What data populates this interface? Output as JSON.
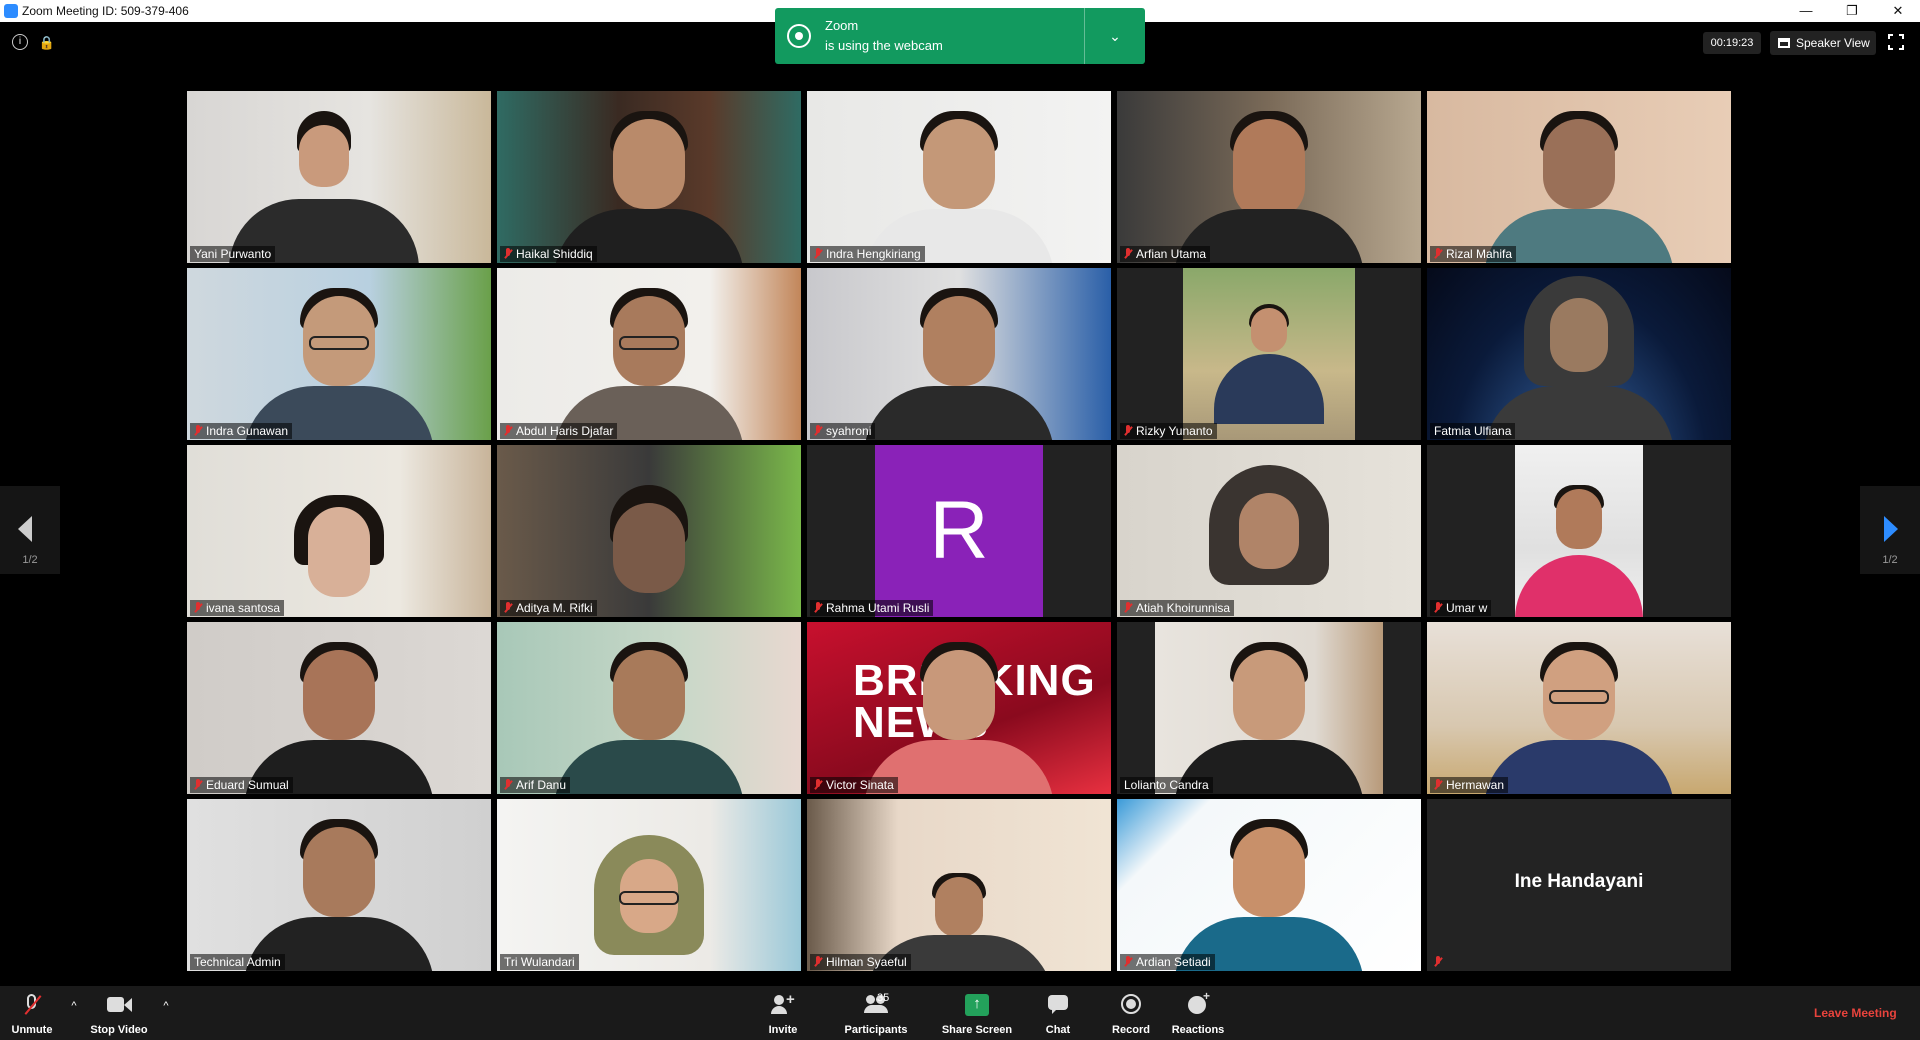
{
  "window": {
    "title": "Zoom Meeting ID: 509-379-406",
    "minimize": "—",
    "restore": "❐",
    "close": "✕"
  },
  "notification": {
    "line1": "Zoom",
    "line2": "is using the webcam",
    "chevron": "⌄"
  },
  "topbar": {
    "timer": "00:19:23",
    "speaker_view": "Speaker View",
    "info": "i",
    "lock": "🔒"
  },
  "pager": {
    "left_page": "1/2",
    "right_page": "1/2"
  },
  "participants": [
    {
      "name": "Yani Purwanto",
      "muted": false,
      "active": true
    },
    {
      "name": "Haikal Shiddiq",
      "muted": true
    },
    {
      "name": "Indra Hengkiriang",
      "muted": true
    },
    {
      "name": "Arfian Utama",
      "muted": true
    },
    {
      "name": "Rizal Mahifa",
      "muted": true
    },
    {
      "name": "Indra Gunawan",
      "muted": true
    },
    {
      "name": "Abdul Haris Djafar",
      "muted": true
    },
    {
      "name": "syahroni",
      "muted": true
    },
    {
      "name": "Rizky Yunanto",
      "muted": true
    },
    {
      "name": "Fatmia Ulfiana",
      "muted": false
    },
    {
      "name": "ivana santosa",
      "muted": true
    },
    {
      "name": "Aditya M. Rifki",
      "muted": true
    },
    {
      "name": "Rahma Utami Rusli",
      "muted": true,
      "avatar": "R"
    },
    {
      "name": "Atiah Khoirunnisa",
      "muted": true
    },
    {
      "name": "Umar w",
      "muted": true
    },
    {
      "name": "Eduard Sumual",
      "muted": true
    },
    {
      "name": "Arif Danu",
      "muted": true
    },
    {
      "name": "Victor Sinata",
      "muted": true
    },
    {
      "name": "Lolianto Candra",
      "muted": false
    },
    {
      "name": "Hermawan",
      "muted": true
    },
    {
      "name": "Technical Admin",
      "muted": false
    },
    {
      "name": "Tri Wulandari",
      "muted": false
    },
    {
      "name": "Hilman Syaeful",
      "muted": true
    },
    {
      "name": "Ardian Setiadi",
      "muted": true
    },
    {
      "name": "Ine Handayani",
      "muted": true,
      "video_off": true
    }
  ],
  "tile_text": {
    "victor_bg_text": "BREAKING NEWS"
  },
  "toolbar": {
    "unmute": "Unmute",
    "stop_video": "Stop Video",
    "invite": "Invite",
    "participants": "Participants",
    "participant_count": "35",
    "share_screen": "Share Screen",
    "chat": "Chat",
    "record": "Record",
    "reactions": "Reactions",
    "leave": "Leave Meeting",
    "caret": "^"
  },
  "colors": {
    "accent_green": "#129a5f",
    "active_speaker_border": "#c8e65a",
    "leave_red": "#e8433c",
    "avatar_purple": "#8a22b8",
    "pager_arrow_blue": "#2d8cff"
  }
}
